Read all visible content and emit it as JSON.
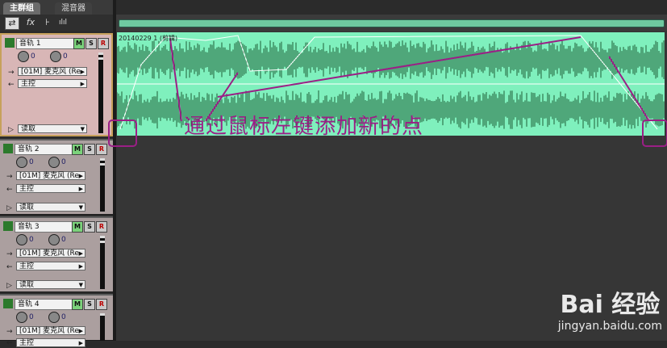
{
  "tabs": [
    {
      "label": "主群组"
    },
    {
      "label": "混音器"
    }
  ],
  "toolbar": {
    "swap_icon": "⇄",
    "fx_icon": "fx",
    "send_icon": "⊦",
    "eq_icon": "ılıl"
  },
  "tracks": [
    {
      "name": "音轨 1",
      "mute": "M",
      "solo": "S",
      "rec": "R",
      "vol": "0",
      "pan": "0",
      "input": "[01M] 麦克风 (Re",
      "output": "主控",
      "mode": "读取"
    },
    {
      "name": "音轨 2",
      "mute": "M",
      "solo": "S",
      "rec": "R",
      "vol": "0",
      "pan": "0",
      "input": "[01M] 麦克风 (Re",
      "output": "主控",
      "mode": "读取"
    },
    {
      "name": "音轨 3",
      "mute": "M",
      "solo": "S",
      "rec": "R",
      "vol": "0",
      "pan": "0",
      "input": "[01M] 麦克风 (Re",
      "output": "主控",
      "mode": "读取"
    },
    {
      "name": "音轨 4",
      "mute": "M",
      "solo": "S",
      "rec": "R",
      "vol": "0",
      "pan": "0",
      "input": "[01M] 麦克风 (Re",
      "output": "主控"
    }
  ],
  "clip": {
    "title": "20140229 1 (剪辑)"
  },
  "annotation": "通过鼠标左键添加新的点",
  "watermark": {
    "brand": "Bai 经验",
    "url": "jingyan.baidu.com"
  },
  "colors": {
    "waveform": "#7ff0bd",
    "wave_dark": "#1f5e36",
    "annotation": "#9b1f86",
    "track_selected": "#d8b6b6"
  }
}
